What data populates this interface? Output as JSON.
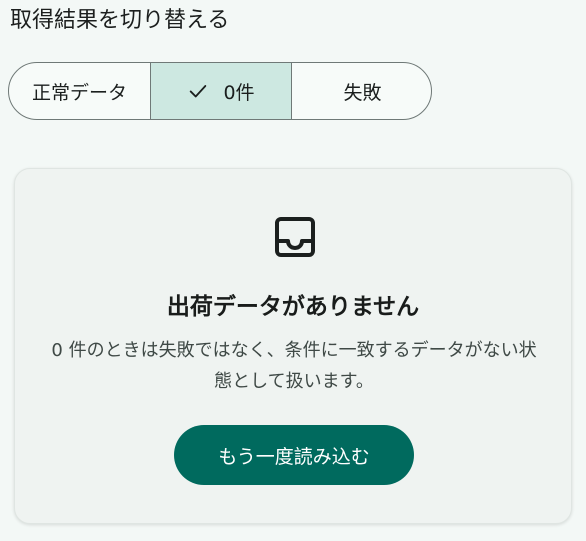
{
  "header": {
    "title": "取得結果を切り替える"
  },
  "segments": [
    {
      "label": "正常データ",
      "selected": false
    },
    {
      "label": "0件",
      "selected": true,
      "icon": "check-icon"
    },
    {
      "label": "失敗",
      "selected": false
    }
  ],
  "empty_state": {
    "icon": "inbox-icon",
    "title": "出荷データがありません",
    "description": "0 件のときは失敗ではなく、条件に一致するデータがない状態として扱います。",
    "button_label": "もう一度読み込む"
  },
  "colors": {
    "accent": "#006a5e",
    "selected_segment": "#cde8e1",
    "background": "#f3f8f6",
    "card": "#eff3f1"
  }
}
